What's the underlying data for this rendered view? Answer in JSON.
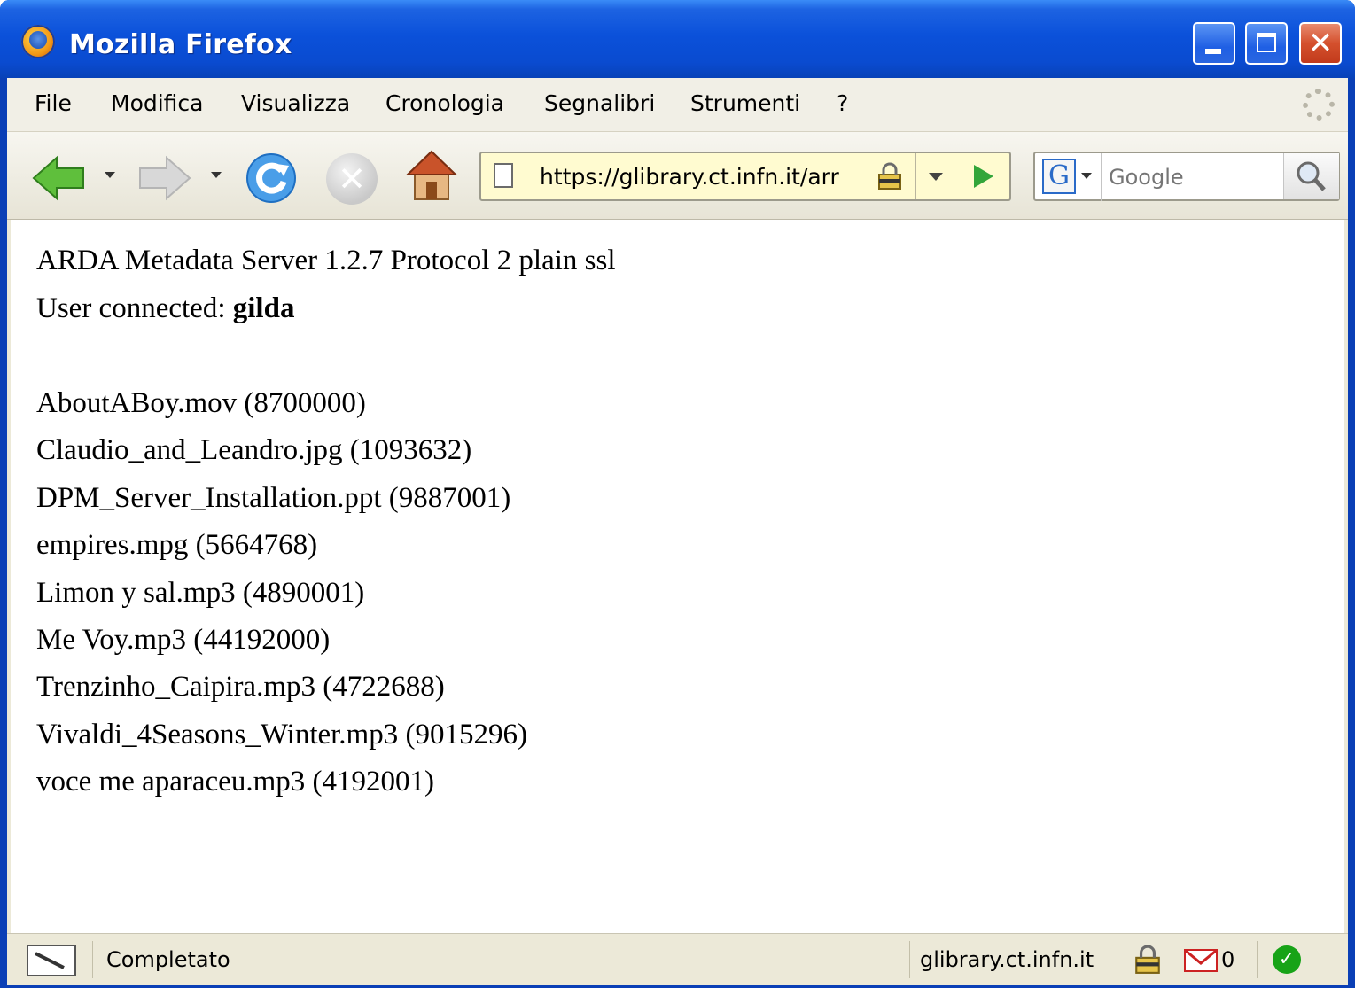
{
  "window": {
    "title": "Mozilla Firefox"
  },
  "menu": [
    "File",
    "Modifica",
    "Visualizza",
    "Cronologia",
    "Segnalibri",
    "Strumenti",
    "?"
  ],
  "address_bar": {
    "url": "https://glibrary.ct.infn.it/arr"
  },
  "search": {
    "engine": "G",
    "placeholder": "Google"
  },
  "page": {
    "line1": "ARDA Metadata Server 1.2.7 Protocol 2 plain ssl",
    "line2_prefix": "User connected: ",
    "user": "gilda",
    "files": [
      "AboutABoy.mov (8700000)",
      "Claudio_and_Leandro.jpg (1093632)",
      "DPM_Server_Installation.ppt (9887001)",
      "empires.mpg (5664768)",
      "Limon y sal.mp3 (4890001)",
      "Me Voy.mp3 (44192000)",
      "Trenzinho_Caipira.mp3 (4722688)",
      "Vivaldi_4Seasons_Winter.mp3 (9015296)",
      "voce me aparaceu.mp3 (4192001)"
    ]
  },
  "status": {
    "text": "Completato",
    "host": "glibrary.ct.infn.it",
    "mail_count": "0"
  }
}
